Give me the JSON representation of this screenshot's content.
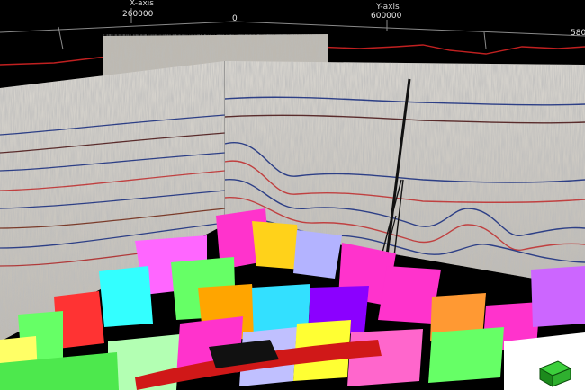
{
  "viewer": {
    "x_axis": {
      "title": "X-axis",
      "ticks": [
        "260000",
        "0"
      ]
    },
    "y_axis": {
      "title": "Y-axis",
      "ticks": [
        "600000",
        "580"
      ]
    }
  },
  "colors": {
    "background": "#000000",
    "axis_line": "#8a8a8a",
    "horizon_line": "#c02020",
    "well_track": "#111111",
    "nav_cube": "#2fb02f"
  },
  "icons": {
    "navigation": "orientation-cube-icon"
  }
}
